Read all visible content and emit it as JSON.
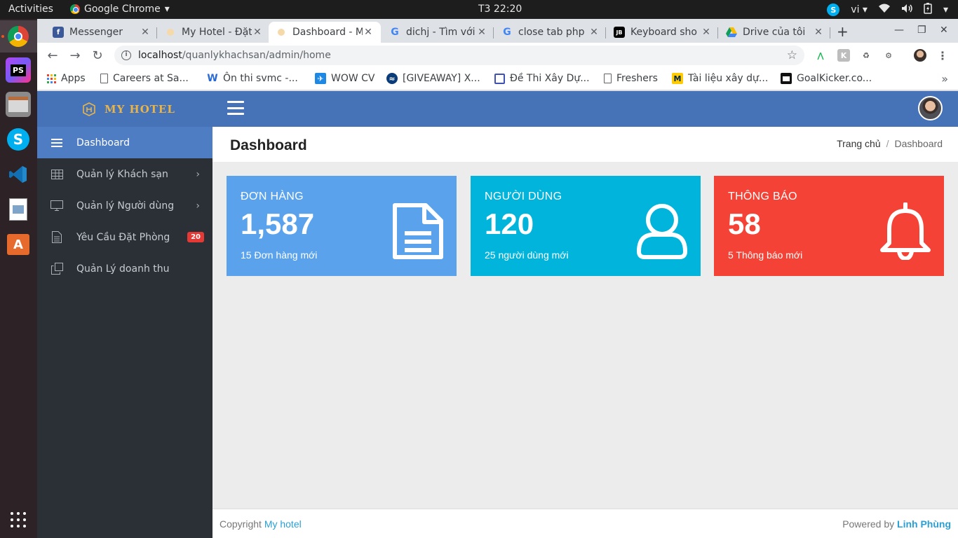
{
  "os": {
    "activities": "Activities",
    "app_name": "Google Chrome",
    "clock": "T3 22:20",
    "lang": "vi"
  },
  "browser": {
    "tabs": [
      {
        "title": "Messenger",
        "icon": "facebook-icon"
      },
      {
        "title": "My Hotel - Đặt",
        "icon": "hotel-icon"
      },
      {
        "title": "Dashboard - M",
        "icon": "hotel-icon",
        "active": true
      },
      {
        "title": "dichj - Tìm với",
        "icon": "google-icon"
      },
      {
        "title": "close tab php",
        "icon": "google-icon"
      },
      {
        "title": "Keyboard sho",
        "icon": "jetbrains-icon"
      },
      {
        "title": "Drive của tôi",
        "icon": "drive-icon"
      }
    ],
    "address": {
      "host": "localhost",
      "path": "/quanlykhachsan/admin/home"
    },
    "bookmarks": [
      {
        "label": "Apps"
      },
      {
        "label": "Careers at Sa..."
      },
      {
        "label": "Ôn thi svmc -..."
      },
      {
        "label": "WOW CV"
      },
      {
        "label": "[GIVEAWAY] X..."
      },
      {
        "label": "Đề Thi Xây Dự..."
      },
      {
        "label": "Freshers"
      },
      {
        "label": "Tài liệu xây dự..."
      },
      {
        "label": "GoalKicker.co..."
      }
    ]
  },
  "app": {
    "brand": "MY HOTEL",
    "menu": [
      {
        "label": "Dashboard",
        "icon": "menu-icon",
        "active": true
      },
      {
        "label": "Quản lý Khách sạn",
        "icon": "table-icon",
        "has_children": true
      },
      {
        "label": "Quản lý Người dùng",
        "icon": "monitor-icon",
        "has_children": true
      },
      {
        "label": "Yêu Cầu Đặt Phòng",
        "icon": "document-icon",
        "badge": "20"
      },
      {
        "label": "Quản Lý doanh thu",
        "icon": "copy-icon"
      }
    ],
    "page_title": "Dashboard",
    "breadcrumb": {
      "home": "Trang chủ",
      "current": "Dashboard"
    },
    "cards": [
      {
        "label": "ĐƠN HÀNG",
        "value": "1,587",
        "sub": "15 Đơn hàng mới",
        "color": "#5aa3ec",
        "icon": "document-icon"
      },
      {
        "label": "NGƯỜI DÙNG",
        "value": "120",
        "sub": "25 người dùng mới",
        "color": "#00b4dc",
        "icon": "user-icon"
      },
      {
        "label": "THÔNG BÁO",
        "value": "58",
        "sub": "5 Thông báo mới",
        "color": "#f44336",
        "icon": "bell-icon"
      }
    ],
    "footer": {
      "copyright_prefix": "Copyright",
      "copyright_link": "My hotel",
      "powered_prefix": "Powered by",
      "powered_link": "Linh Phùng"
    }
  }
}
